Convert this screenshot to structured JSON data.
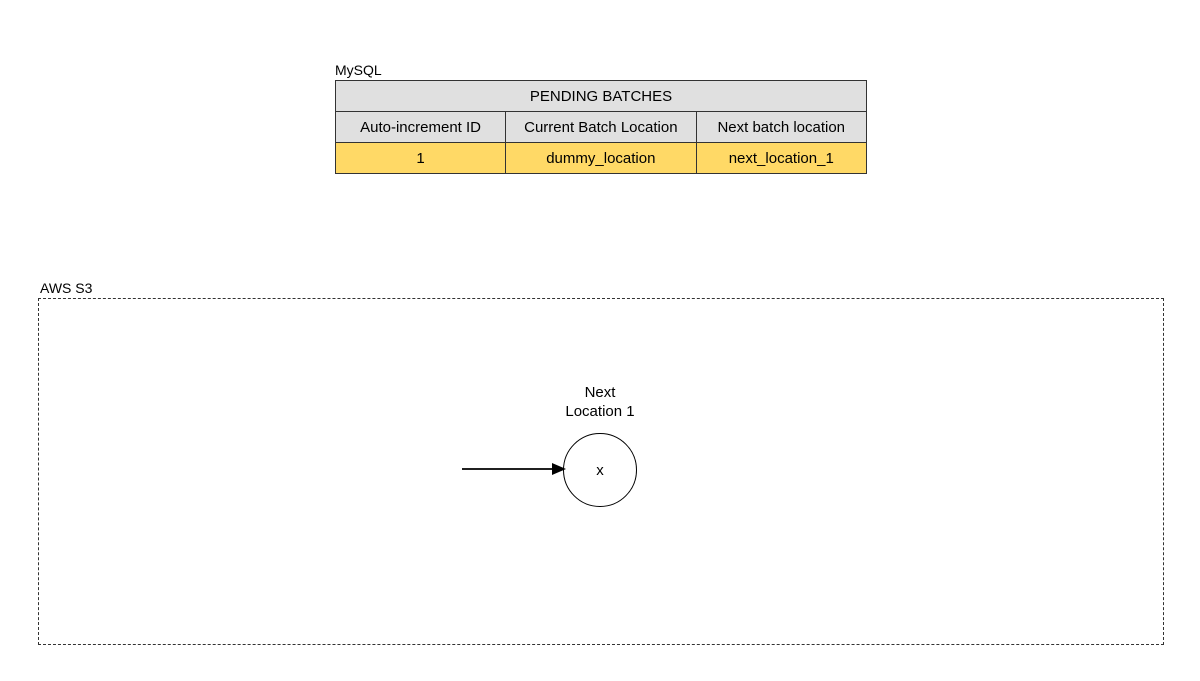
{
  "mysql": {
    "label": "MySQL",
    "table_title": "PENDING BATCHES",
    "columns": {
      "id": "Auto-increment ID",
      "current": "Current Batch Location",
      "next": "Next batch location"
    },
    "rows": [
      {
        "id": "1",
        "current": "dummy_location",
        "next": "next_location_1"
      }
    ]
  },
  "aws": {
    "label": "AWS S3",
    "node": {
      "label_line1": "Next",
      "label_line2": "Location 1",
      "content": "x"
    }
  }
}
